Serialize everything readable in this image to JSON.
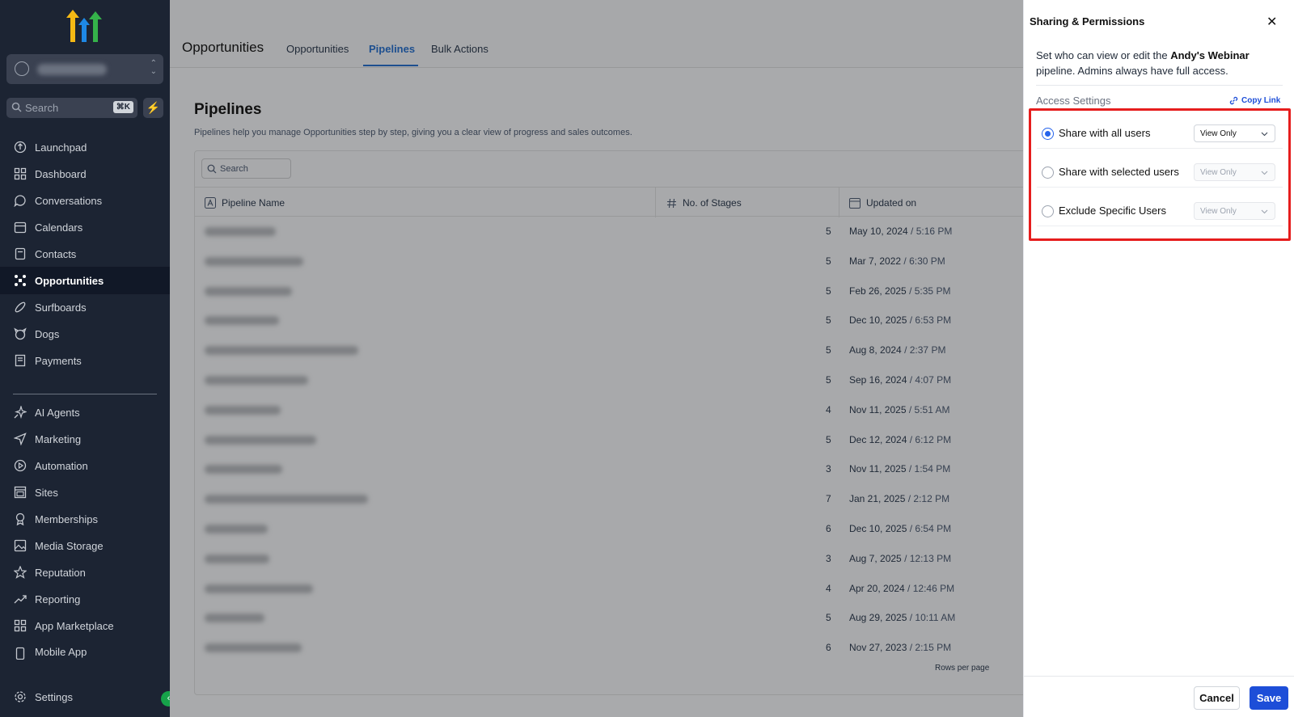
{
  "sidebar": {
    "search_placeholder": "Search",
    "search_shortcut": "⌘K",
    "items_top": [
      {
        "label": "Launchpad",
        "icon": "launchpad-icon"
      },
      {
        "label": "Dashboard",
        "icon": "dashboard-icon"
      },
      {
        "label": "Conversations",
        "icon": "chat-icon"
      },
      {
        "label": "Calendars",
        "icon": "calendar-icon"
      },
      {
        "label": "Contacts",
        "icon": "contacts-icon"
      },
      {
        "label": "Opportunities",
        "icon": "opportunities-icon",
        "active": true
      },
      {
        "label": "Surfboards",
        "icon": "surfboard-icon"
      },
      {
        "label": "Dogs",
        "icon": "dog-icon"
      },
      {
        "label": "Payments",
        "icon": "payments-icon"
      }
    ],
    "items_bottom": [
      {
        "label": "AI Agents",
        "icon": "sparkle-icon"
      },
      {
        "label": "Marketing",
        "icon": "send-icon"
      },
      {
        "label": "Automation",
        "icon": "automation-icon"
      },
      {
        "label": "Sites",
        "icon": "sites-icon"
      },
      {
        "label": "Memberships",
        "icon": "membership-icon"
      },
      {
        "label": "Media Storage",
        "icon": "image-icon"
      },
      {
        "label": "Reputation",
        "icon": "star-icon"
      },
      {
        "label": "Reporting",
        "icon": "chart-icon"
      },
      {
        "label": "App Marketplace",
        "icon": "grid-icon"
      },
      {
        "label": "Mobile App",
        "icon": "mobile-icon"
      }
    ],
    "settings_label": "Settings"
  },
  "header": {
    "title": "Opportunities",
    "tabs": [
      {
        "label": "Opportunities"
      },
      {
        "label": "Pipelines",
        "active": true
      },
      {
        "label": "Bulk Actions"
      }
    ]
  },
  "main": {
    "title": "Pipelines",
    "description": "Pipelines help you manage Opportunities step by step, giving you a clear view of progress and sales outcomes.",
    "search_placeholder": "Search",
    "columns": [
      "Pipeline Name",
      "No. of Stages",
      "Updated on"
    ],
    "rows": [
      {
        "stages": "5",
        "date": "May 10, 2024",
        "time": "5:16 PM"
      },
      {
        "stages": "5",
        "date": "Mar 7, 2022",
        "time": "6:30 PM"
      },
      {
        "stages": "5",
        "date": "Feb 26, 2025",
        "time": "5:35 PM"
      },
      {
        "stages": "5",
        "date": "Dec 10, 2025",
        "time": "6:53 PM"
      },
      {
        "stages": "5",
        "date": "Aug 8, 2024",
        "time": "2:37 PM"
      },
      {
        "stages": "5",
        "date": "Sep 16, 2024",
        "time": "4:07 PM"
      },
      {
        "stages": "4",
        "date": "Nov 11, 2025",
        "time": "5:51 AM"
      },
      {
        "stages": "5",
        "date": "Dec 12, 2024",
        "time": "6:12 PM"
      },
      {
        "stages": "3",
        "date": "Nov 11, 2025",
        "time": "1:54 PM"
      },
      {
        "stages": "7",
        "date": "Jan 21, 2025",
        "time": "2:12 PM"
      },
      {
        "stages": "6",
        "date": "Dec 10, 2025",
        "time": "6:54 PM"
      },
      {
        "stages": "3",
        "date": "Aug 7, 2025",
        "time": "12:13 PM"
      },
      {
        "stages": "4",
        "date": "Apr 20, 2024",
        "time": "12:46 PM"
      },
      {
        "stages": "5",
        "date": "Aug 29, 2025",
        "time": "10:11 AM"
      },
      {
        "stages": "6",
        "date": "Nov 27, 2023",
        "time": "2:15 PM"
      }
    ],
    "rows_per_page_label": "Rows per page"
  },
  "panel": {
    "title": "Sharing & Permissions",
    "desc_pre": "Set who can view or edit the ",
    "pipeline_name": "Andy's Webinar",
    "desc_post": " pipeline. Admins always have full access.",
    "access_label": "Access Settings",
    "copy_link": "Copy Link",
    "options": [
      {
        "label": "Share with all users",
        "permission": "View Only",
        "selected": true
      },
      {
        "label": "Share with selected users",
        "permission": "View Only",
        "selected": false
      },
      {
        "label": "Exclude Specific Users",
        "permission": "View Only",
        "selected": false
      }
    ],
    "cancel_label": "Cancel",
    "save_label": "Save"
  },
  "colors": {
    "sidebar_bg": "#1c2433",
    "accent_blue": "#1d4ed8",
    "highlight_red": "#e61d1d",
    "bolt_green": "#22c55e"
  }
}
